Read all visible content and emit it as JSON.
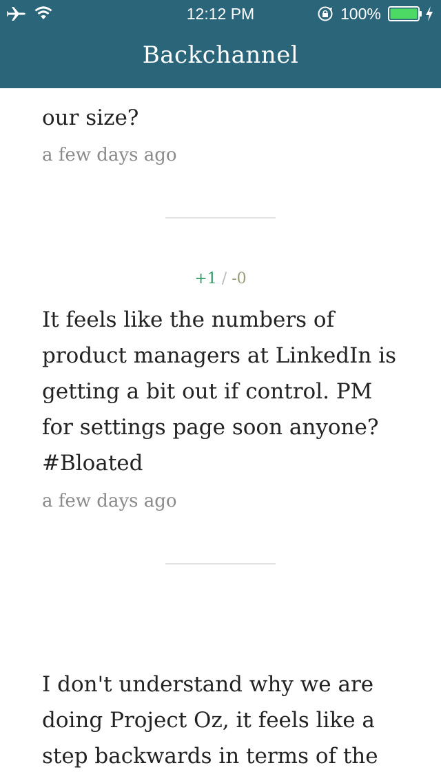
{
  "status_bar": {
    "time": "12:12 PM",
    "battery_percent": "100%",
    "battery_level": 1.0,
    "icons": [
      "airplane-icon",
      "wifi-icon",
      "rotation-lock-icon",
      "battery-icon",
      "charging-icon"
    ]
  },
  "nav": {
    "title": "Backchannel"
  },
  "colors": {
    "nav_background": "#2b6579",
    "upvote": "#2e9a62",
    "downvote": "#9a9a78",
    "timestamp": "#8a8a8a"
  },
  "posts": [
    {
      "partial_text": "our size?",
      "time": "a few days ago"
    },
    {
      "upvotes": "+1",
      "separator": "/",
      "downvotes": "-0",
      "text": "It feels like the numbers of\nproduct managers at LinkedIn is\ngetting a bit out if control. PM\nfor settings page soon anyone?\n#Bloated",
      "time": "a few days ago"
    },
    {
      "text": "I don't understand why we are\ndoing Project Oz, it feels like a\nstep backwards in terms of the"
    }
  ]
}
